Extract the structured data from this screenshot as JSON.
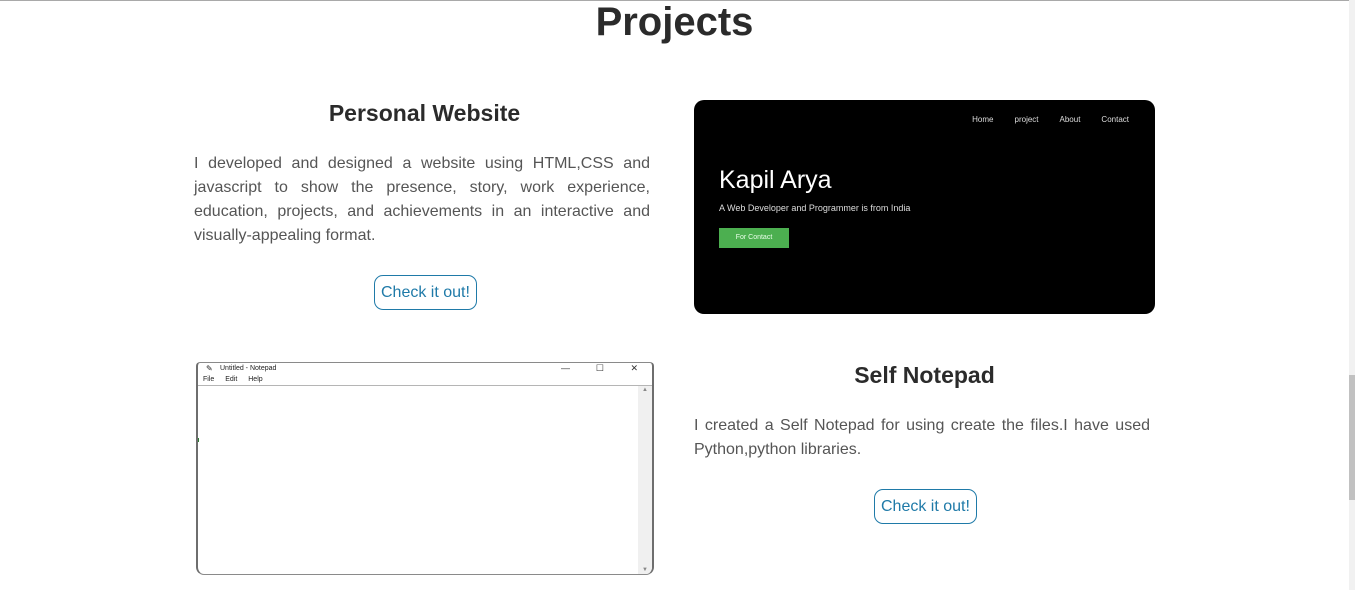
{
  "page": {
    "title": "Projects"
  },
  "projects": [
    {
      "title": "Personal Website",
      "description": "I developed and designed a website using HTML,CSS and javascript to show the presence, story, work experience, education, projects, and achievements in an interactive and visually-appealing format.",
      "button": "Check it out!",
      "screenshot": {
        "nav": [
          "Home",
          "project",
          "About",
          "Contact"
        ],
        "name": "Kapil Arya",
        "tagline": "A Web Developer and Programmer is from India",
        "cta": "For Contact"
      }
    },
    {
      "title": "Self Notepad",
      "description": "I created a Self Notepad for using create the files.I have used Python,python libraries.",
      "button": "Check it out!",
      "screenshot": {
        "window_title": "Untitled - Notepad",
        "menu": [
          "File",
          "Edit",
          "Help"
        ],
        "controls": [
          "—",
          "☐",
          "✕"
        ]
      }
    }
  ],
  "colors": {
    "accent": "#1f7aa8",
    "cta_green": "#4caf50",
    "heading": "#2b2b2b",
    "body_text": "#555555"
  }
}
